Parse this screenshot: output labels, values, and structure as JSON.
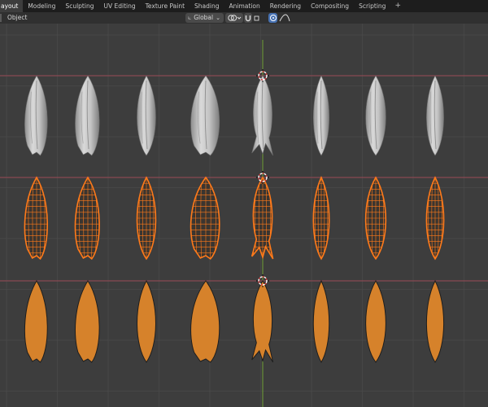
{
  "workspace_tabs": [
    {
      "label": "ayout",
      "active": true
    },
    {
      "label": "Modeling",
      "active": false
    },
    {
      "label": "Sculpting",
      "active": false
    },
    {
      "label": "UV Editing",
      "active": false
    },
    {
      "label": "Texture Paint",
      "active": false
    },
    {
      "label": "Shading",
      "active": false
    },
    {
      "label": "Animation",
      "active": false
    },
    {
      "label": "Rendering",
      "active": false
    },
    {
      "label": "Compositing",
      "active": false
    },
    {
      "label": "Scripting",
      "active": false
    }
  ],
  "add_tab_label": "+",
  "header": {
    "object_menu": "Object",
    "transform_orientation": "Global",
    "orientation_icon": "transform-axes-icon",
    "chevron": "⌄"
  },
  "icons": {
    "add_workspace": "plus-icon",
    "snap": "snap-magnet-icon",
    "pivot": "pivot-point-icon",
    "proportional": "proportional-edit-icon",
    "falloff": "falloff-curve-icon"
  },
  "colors": {
    "viewport_bg": "#3d3d3d",
    "grid_line": "#4a4a4a",
    "x_axis": "#9b4a56",
    "y_axis": "#6ea035",
    "selection_orange": "#ff7a1a",
    "flat_orange": "#d6822b",
    "sculpt_grey": "#c4c4c4"
  },
  "scene": {
    "rows": [
      "sculpted-petals",
      "wireframe-petals",
      "flat-petals"
    ],
    "petal_count_per_row": 8
  }
}
